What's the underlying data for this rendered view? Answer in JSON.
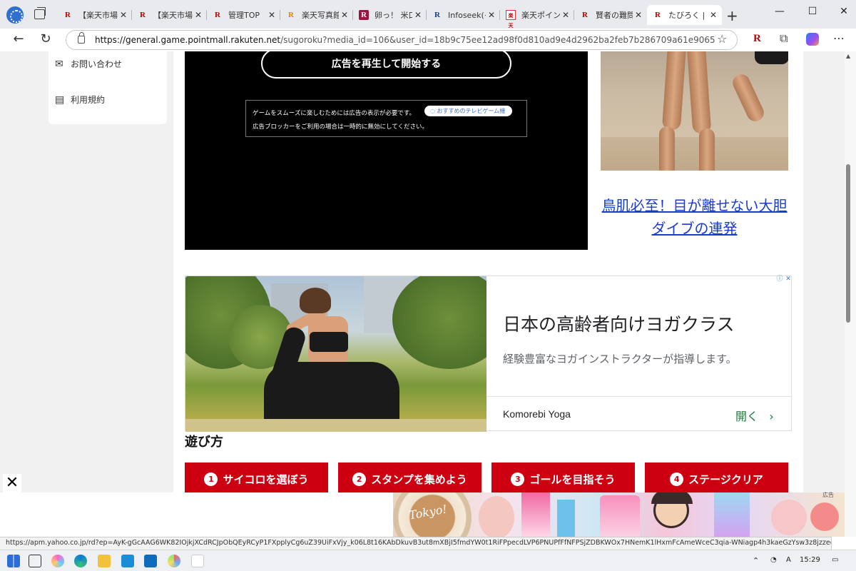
{
  "browser": {
    "tabs": [
      {
        "favicon": "R",
        "title": "【楽天市場】"
      },
      {
        "favicon": "R",
        "title": "【楽天市場】"
      },
      {
        "favicon": "R",
        "title": "管理TOP"
      },
      {
        "favicon": "R",
        "title": "楽天写真館"
      },
      {
        "favicon": "R",
        "title": "卵っ！ 米口"
      },
      {
        "favicon": "R",
        "title": "Infoseek(イ"
      },
      {
        "favicon": "楽天",
        "title": "楽天ポイント"
      },
      {
        "favicon": "R",
        "title": "賢者の難問"
      },
      {
        "favicon": "R",
        "title": "たびろく | 楽"
      }
    ],
    "url_host": "https://general.game.pointmall.rakuten.net",
    "url_rest": "/sugoroku?media_id=106&user_id=18b9c75ee12ad98f0d810ad9e4d2962ba2feb7b286709a61e90651ad6221954...",
    "status_url": "https://apm.yahoo.co.jp/rd?ep=AyK-gGcAAG6WK82IOjkjXCdRCJpObQEyRCyP1FXpplyCg6uZ39UiFxVjy_k06L8t16KAbDkuvB3ut8mXBjI5fmdYW0t1RiFPpecdLVP6PNUPfFfNFPSjZDBKWOx7HNemK1lHxmFcAmeWceC3qia-WNiagp4h3kaeGzYsw3z8jzzee..."
  },
  "sidebar": {
    "contact_label": "お問い合わせ",
    "terms_label": "利用規約"
  },
  "game": {
    "start_button": "広告を再生して開始する",
    "notice_line1": "ゲームをスムーズに楽しむためには広告の表示が必要です。",
    "notice_line2": "広告ブロッカーをご利用の場合は一時的に無効にしてください。",
    "tv_link": "おすすめのテレビゲーム機"
  },
  "side_ad": {
    "caption": "鳥肌必至！目が離せない大胆ダイブの連発"
  },
  "banner_ad": {
    "title": "日本の高齢者向けヨガクラス",
    "description": "経験豊富なヨガインストラクターが指導します。",
    "brand": "Komorebi Yoga",
    "cta": "開く"
  },
  "howto": {
    "title": "遊び方",
    "steps": [
      {
        "num": "1",
        "label": "サイコロを選ぼう"
      },
      {
        "num": "2",
        "label": "スタンプを集めよう"
      },
      {
        "num": "3",
        "label": "ゴールを目指そう"
      },
      {
        "num": "4",
        "label": "ステージクリア"
      }
    ]
  },
  "bottom_ad": {
    "label": "広告",
    "cup_text": "Tokyo!"
  },
  "taskbar": {
    "time": "15:29",
    "ime": "A"
  },
  "colors": {
    "rakuten_red": "#bf0000",
    "step_red": "#cc0011",
    "link_blue": "#1a3cc9",
    "cta_green": "#1a7a3a"
  }
}
